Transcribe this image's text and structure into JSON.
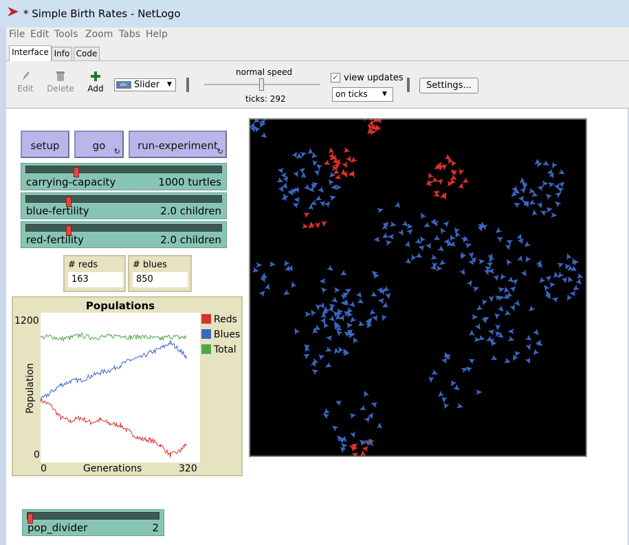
{
  "window": {
    "title": "* Simple Birth Rates - NetLogo"
  },
  "menu": [
    "File",
    "Edit",
    "Tools",
    "Zoom",
    "Tabs",
    "Help"
  ],
  "tabs": [
    "Interface",
    "Info",
    "Code"
  ],
  "toolbar": {
    "edit_label": "Edit",
    "delete_label": "Delete",
    "add_label": "Add",
    "widget_type": "Slider",
    "widget_type_icon": "abc-slider-icon",
    "speed_label": "normal speed",
    "speed_value": 0.5,
    "ticks_label": "ticks: 292",
    "view_updates_label": "view updates",
    "view_updates_checked": true,
    "update_mode": "on ticks",
    "settings_label": "Settings..."
  },
  "buttons": {
    "setup": "setup",
    "go": "go",
    "run_experiment": "run-experiment"
  },
  "sliders": [
    {
      "name": "carrying-capacity",
      "value": "1000 turtles",
      "level": 0.25
    },
    {
      "name": "blue-fertility",
      "value": "2.0 children",
      "level": 0.21
    },
    {
      "name": "red-fertility",
      "value": "2.0 children",
      "level": 0.21
    }
  ],
  "monitors": [
    {
      "label": "# reds",
      "value": "163"
    },
    {
      "label": "# blues",
      "value": "850"
    }
  ],
  "bottom_slider": {
    "name": "pop_divider",
    "value": "2",
    "level": 0.0
  },
  "colors": {
    "red": "#d9312c",
    "blue": "#3a67c4",
    "green": "#4ea84a"
  },
  "chart_data": {
    "type": "line",
    "title": "Populations",
    "xlabel": "Generations",
    "ylabel": "Population",
    "xlim": [
      0,
      320
    ],
    "ylim": [
      0,
      1200
    ],
    "x_tick_labels": [
      "0",
      "320"
    ],
    "y_tick_labels": [
      "0",
      "1200"
    ],
    "legend_position": "right",
    "series": [
      {
        "name": "Reds",
        "color": "#d9312c",
        "x": [
          0,
          20,
          40,
          60,
          80,
          100,
          120,
          140,
          160,
          180,
          200,
          220,
          240,
          260,
          280,
          292
        ],
        "y": [
          500,
          460,
          360,
          330,
          360,
          320,
          340,
          310,
          300,
          240,
          190,
          180,
          140,
          60,
          90,
          150
        ]
      },
      {
        "name": "Blues",
        "color": "#3a67c4",
        "x": [
          0,
          20,
          40,
          60,
          80,
          100,
          120,
          140,
          160,
          180,
          200,
          220,
          240,
          260,
          280,
          292
        ],
        "y": [
          500,
          560,
          620,
          650,
          660,
          690,
          720,
          740,
          780,
          820,
          840,
          880,
          910,
          960,
          900,
          850
        ]
      },
      {
        "name": "Total",
        "color": "#4ea84a",
        "x": [
          0,
          20,
          40,
          60,
          80,
          100,
          120,
          140,
          160,
          180,
          200,
          220,
          240,
          260,
          280,
          292
        ],
        "y": [
          1000,
          1010,
          990,
          1000,
          1020,
          1000,
          1005,
          1010,
          1020,
          1000,
          1010,
          1000,
          990,
          1010,
          1000,
          1005
        ]
      }
    ]
  }
}
